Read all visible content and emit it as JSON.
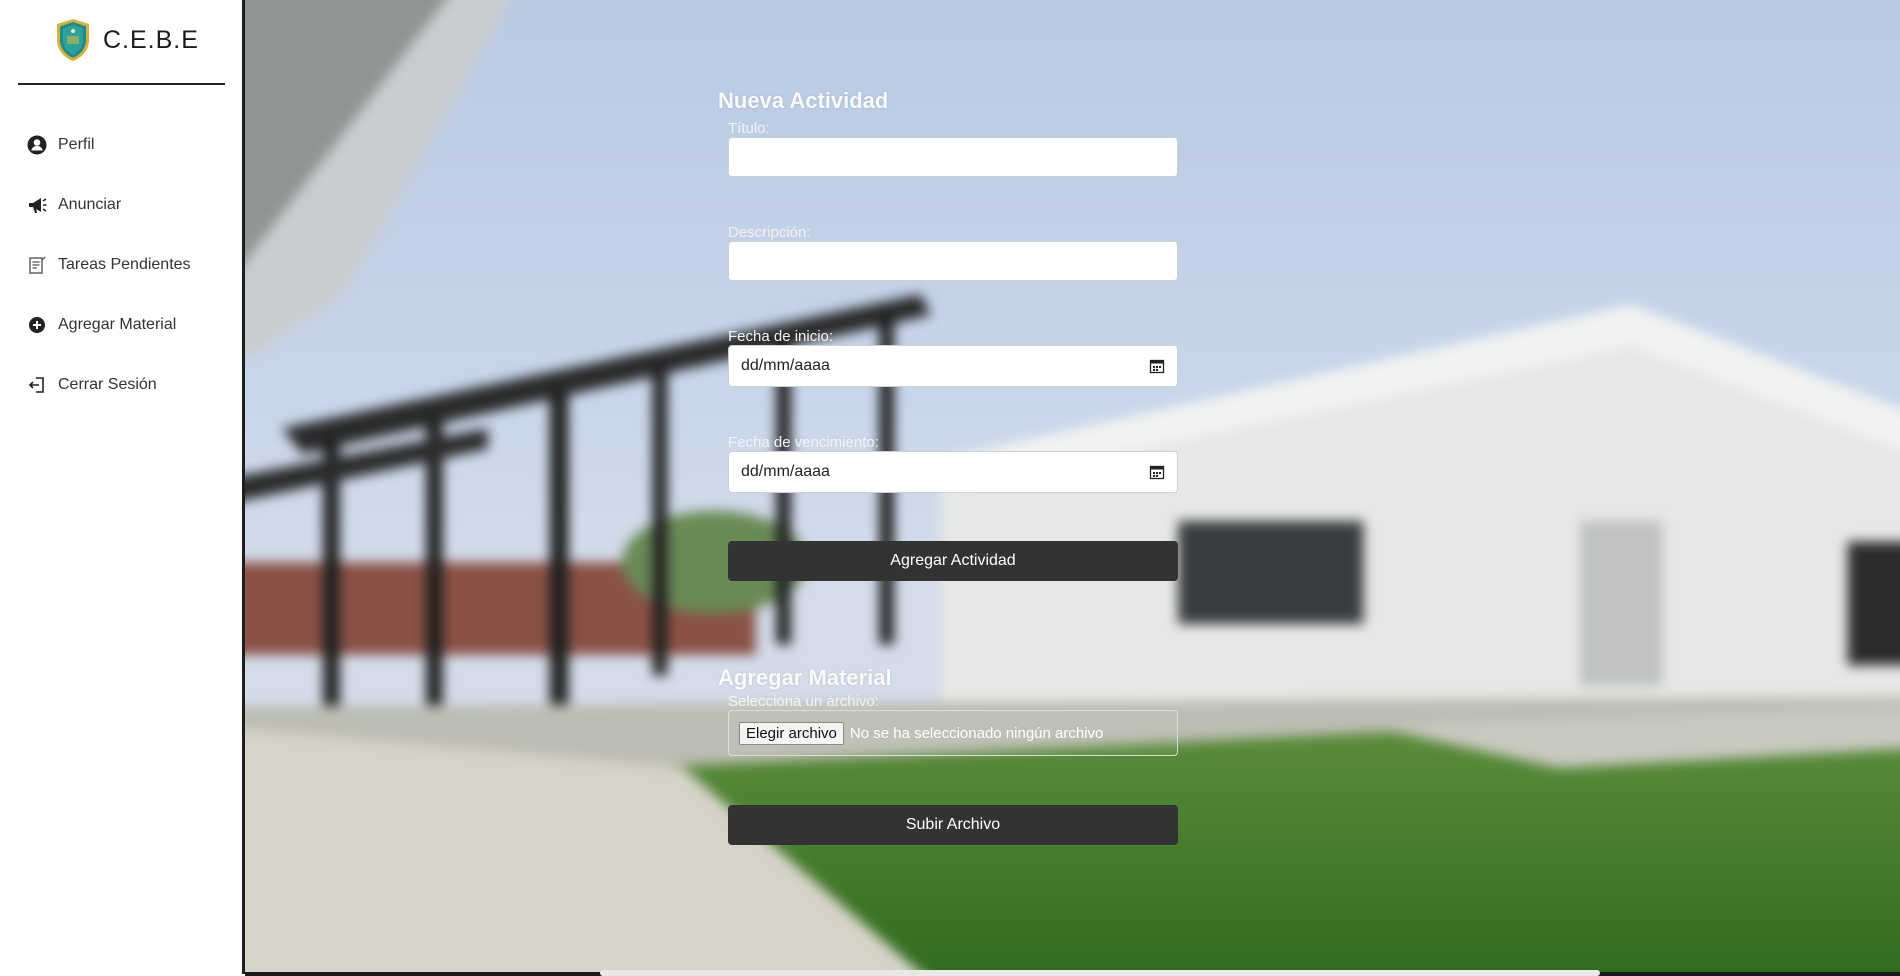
{
  "brand": {
    "name": "C.E.B.E"
  },
  "sidebar": {
    "items": [
      {
        "label": "Perfil",
        "icon": "user-circle-icon"
      },
      {
        "label": "Anunciar",
        "icon": "megaphone-icon"
      },
      {
        "label": "Tareas Pendientes",
        "icon": "task-list-icon"
      },
      {
        "label": "Agregar Material",
        "icon": "plus-circle-icon"
      },
      {
        "label": "Cerrar Sesión",
        "icon": "logout-icon"
      }
    ]
  },
  "activity_form": {
    "title": "Nueva Actividad",
    "titulo_label": "Título:",
    "titulo_value": "",
    "descripcion_label": "Descripción:",
    "descripcion_value": "",
    "fecha_inicio_label": "Fecha de inicio:",
    "fecha_inicio_placeholder": "dd/mm/aaaa",
    "fecha_vencimiento_label": "Fecha de vencimiento:",
    "fecha_vencimiento_placeholder": "dd/mm/aaaa",
    "submit_label": "Agregar Actividad"
  },
  "material_form": {
    "title": "Agregar Material",
    "file_label": "Selecciona un archivo:",
    "choose_button": "Elegir archivo",
    "file_status": "No se ha seleccionado ningún archivo",
    "submit_label": "Subir Archivo"
  },
  "colors": {
    "button_bg": "#333333",
    "sidebar_bg": "#ffffff",
    "logo_teal": "#1f8a86",
    "logo_gold": "#d6b23a"
  }
}
